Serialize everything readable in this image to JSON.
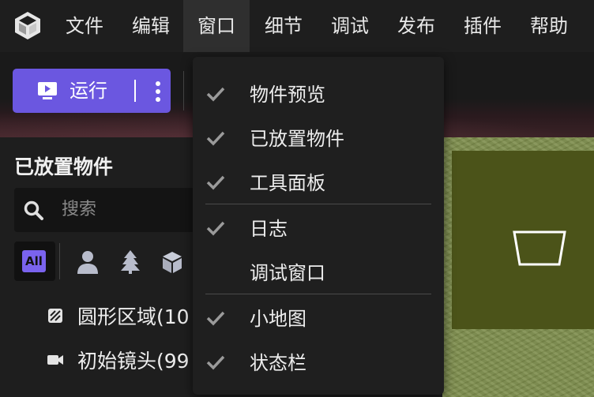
{
  "menubar": {
    "items": [
      "文件",
      "编辑",
      "窗口",
      "细节",
      "调试",
      "发布",
      "插件",
      "帮助"
    ],
    "active": "窗口"
  },
  "toolbar": {
    "run_label": "运行"
  },
  "panel": {
    "title": "已放置物件",
    "search_placeholder": "搜索",
    "filter_all": "All",
    "items": [
      {
        "label": "圆形区域(10",
        "icon": "circle-area-icon"
      },
      {
        "label": "初始镜头(99",
        "icon": "camera-icon"
      }
    ]
  },
  "window_menu": {
    "items": [
      {
        "label": "物件预览",
        "checked": true
      },
      {
        "label": "已放置物件",
        "checked": true
      },
      {
        "label": "工具面板",
        "checked": true
      },
      {
        "label": "日志",
        "checked": true
      },
      {
        "label": "调试窗口",
        "checked": false
      },
      {
        "label": "小地图",
        "checked": true
      },
      {
        "label": "状态栏",
        "checked": true
      }
    ]
  },
  "colors": {
    "accent": "#6b57e0",
    "viewport_grass": "#7f8f4e",
    "minimap_bg": "#4b5319"
  }
}
